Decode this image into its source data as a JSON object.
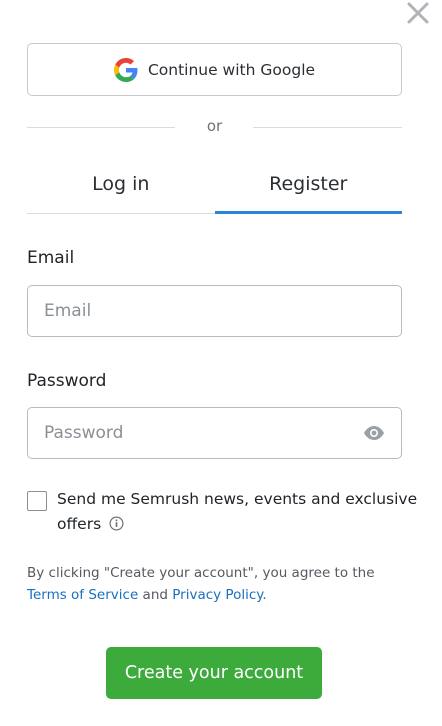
{
  "google": {
    "label": "Continue with Google"
  },
  "divider": {
    "text": "or"
  },
  "tabs": [
    {
      "label": "Log in",
      "active": false
    },
    {
      "label": "Register",
      "active": true
    }
  ],
  "email": {
    "label": "Email",
    "placeholder": "Email",
    "value": ""
  },
  "password": {
    "label": "Password",
    "placeholder": "Password",
    "value": ""
  },
  "newsletter": {
    "label": "Send me Semrush news, events and exclusive offers",
    "checked": false
  },
  "terms": {
    "prefix": "By clicking \"Create your account\", you agree to the",
    "tos": "Terms of Service",
    "and": "and",
    "privacy": "Privacy Policy",
    "suffix": "."
  },
  "submit": {
    "label": "Create your account"
  },
  "colors": {
    "accent": "#2c84d8",
    "primary_button": "#3cab3c",
    "link": "#1a6fc0"
  }
}
